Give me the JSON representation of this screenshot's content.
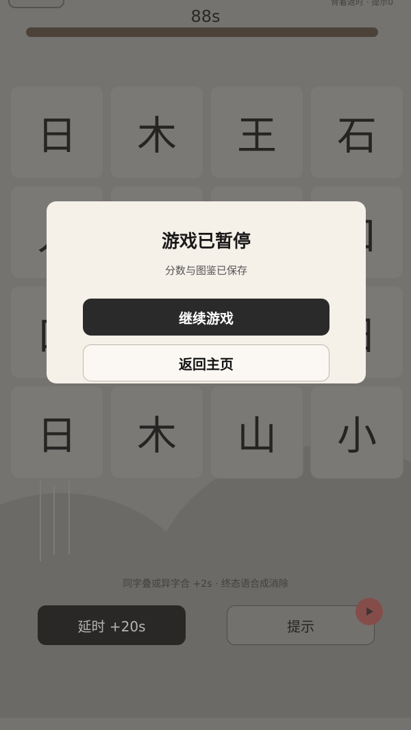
{
  "top_bar": {
    "timer": "88s",
    "top_right_text": "背着返时 · 提示0",
    "progress_fraction": 1.0
  },
  "grid": {
    "tiles": [
      "日",
      "木",
      "王",
      "石",
      "人",
      "",
      "",
      "口",
      "口",
      "",
      "",
      "日",
      "日",
      "木",
      "山",
      "小"
    ]
  },
  "bottom": {
    "hint": "同字叠或异字合 +2s · 终态语合成消除",
    "extend_label": "延时 +20s",
    "tip_label": "提示",
    "play_icon": "play-icon"
  },
  "modal": {
    "title": "游戏已暂停",
    "subtitle": "分数与图鉴已保存",
    "resume_label": "继续游戏",
    "home_label": "返回主页"
  },
  "colors": {
    "overlay": "#4a4845",
    "modal_bg": "#f5f0e8",
    "primary": "#2a2a2a",
    "progress": "#4f3f34",
    "play_button": "#a6504e"
  }
}
